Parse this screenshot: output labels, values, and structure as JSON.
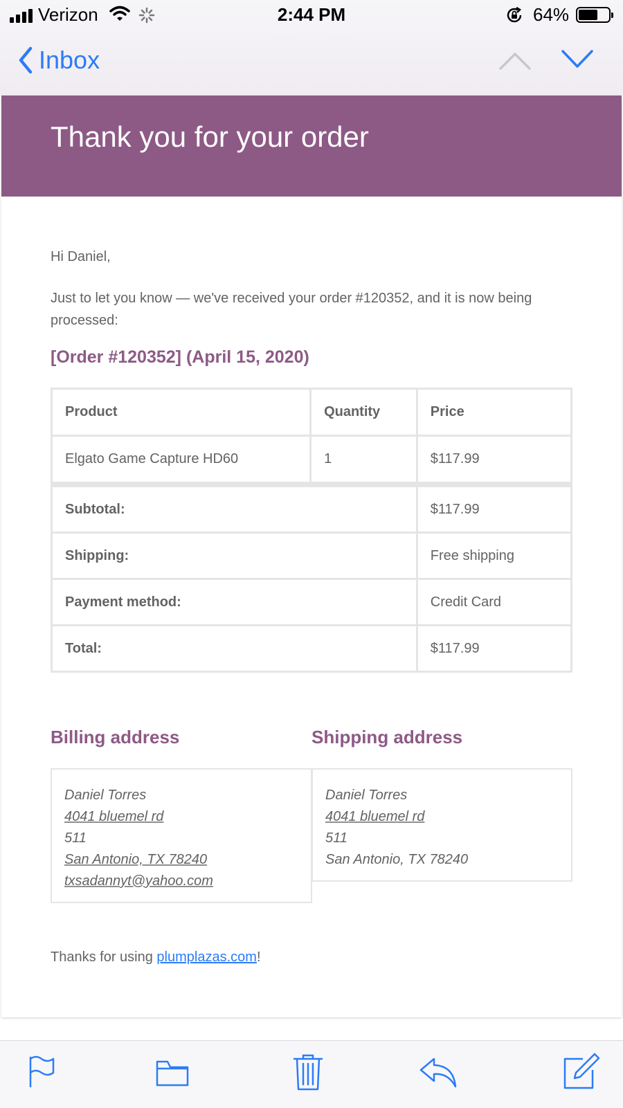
{
  "status_bar": {
    "carrier": "Verizon",
    "time": "2:44 PM",
    "battery": "64%",
    "battery_level": 0.64
  },
  "nav": {
    "back_label": "Inbox",
    "prev_icon": "chevron-up-icon",
    "next_icon": "chevron-down-icon"
  },
  "email": {
    "header_title": "Thank you for your order",
    "header_color": "#8d5a86",
    "greeting": "Hi Daniel,",
    "intro": "Just to let you know — we've received your order #120352, and it is now being processed:",
    "order_title": "[Order #120352] (April 15, 2020)",
    "table": {
      "headers": {
        "product": "Product",
        "quantity": "Quantity",
        "price": "Price"
      },
      "items": [
        {
          "product": "Elgato Game Capture HD60",
          "quantity": "1",
          "price": "$117.99"
        }
      ],
      "totals": [
        {
          "label": "Subtotal:",
          "value": "$117.99"
        },
        {
          "label": "Shipping:",
          "value": "Free shipping"
        },
        {
          "label": "Payment method:",
          "value": "Credit Card"
        },
        {
          "label": "Total:",
          "value": "$117.99"
        }
      ]
    },
    "billing": {
      "heading": "Billing address",
      "name": "Daniel Torres",
      "street": "4041 bluemel rd",
      "unit": "511",
      "city": "San Antonio, TX 78240",
      "email": "txsadannyt@yahoo.com"
    },
    "shipping": {
      "heading": "Shipping address",
      "name": "Daniel Torres",
      "street": "4041 bluemel rd",
      "unit": "511",
      "city": "San Antonio, TX 78240"
    },
    "thanks_prefix": "Thanks for using ",
    "thanks_link": "plumplazas.com",
    "thanks_suffix": "!"
  },
  "toolbar": {
    "icons": [
      "flag-icon",
      "folder-icon",
      "trash-icon",
      "reply-icon",
      "compose-icon"
    ],
    "accent": "#2b7cf6"
  }
}
